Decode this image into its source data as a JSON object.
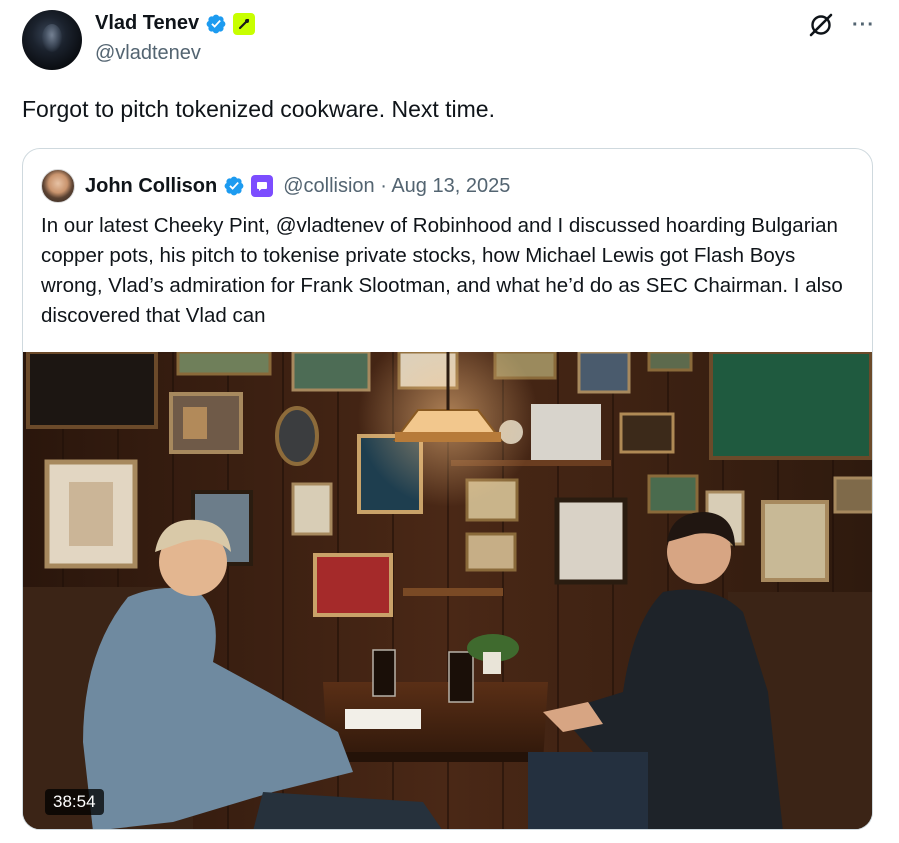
{
  "author": {
    "display_name": "Vlad Tenev",
    "handle": "@vladtenev",
    "verified": true,
    "affiliate_badge_color": "#c8ff00"
  },
  "header_icons": [
    "grok-icon",
    "more-icon"
  ],
  "more_label": "···",
  "tweet": {
    "text": "Forgot to pitch tokenized cookware. Next time."
  },
  "quoted": {
    "display_name": "John Collison",
    "handle": "@collision",
    "date": "Aug 13, 2025",
    "meta": "@collision · Aug 13, 2025",
    "affiliate_badge_color": "#7c4dff",
    "text": "In our latest Cheeky Pint, @vladtenev of Robinhood and I discussed hoarding Bulgarian copper pots, his pitch to tokenise private stocks, how Michael Lewis got Flash Boys wrong, Vlad’s admiration for Frank Slootman, and what he’d do as SEC Chairman. I also discovered that Vlad can",
    "video": {
      "duration": "38:54"
    }
  },
  "colors": {
    "verified_blue": "#1d9bf0",
    "secondary_text": "#536471",
    "primary_text": "#0f1419",
    "border": "#cfd9de"
  }
}
